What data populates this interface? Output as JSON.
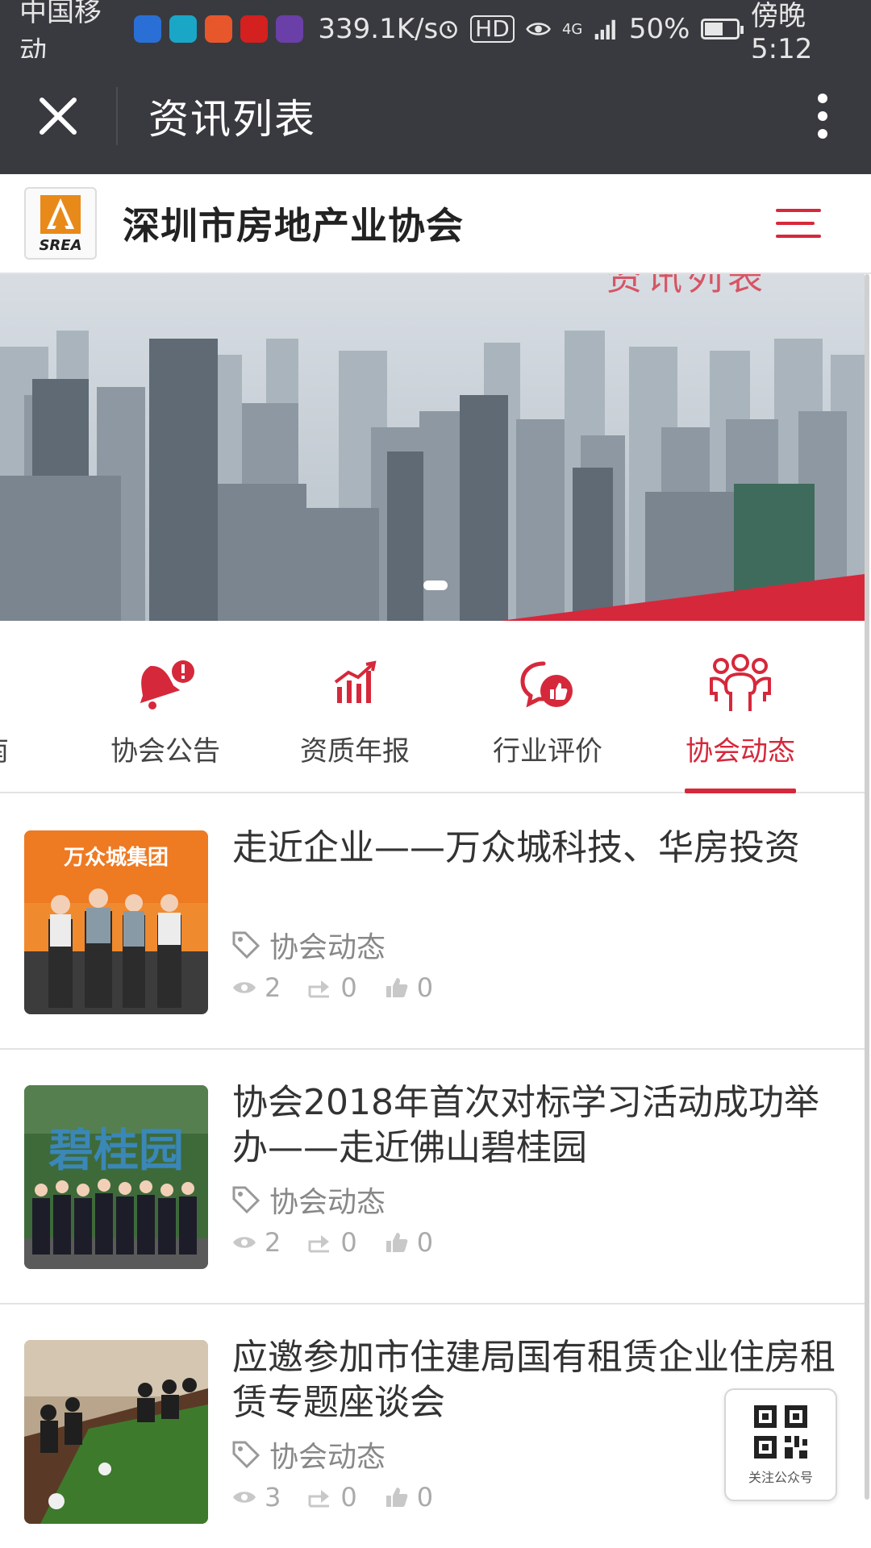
{
  "status_bar": {
    "carrier": "中国移动",
    "speed": "339.1K/s",
    "hd": "HD",
    "network": "4G",
    "battery": "50%",
    "battery_level": 0.5,
    "time": "傍晚5:12"
  },
  "title_bar": {
    "title": "资讯列表"
  },
  "site_header": {
    "logo_text": "SREA",
    "name": "深圳市房地产业协会"
  },
  "banner": {
    "caption": "资讯列表"
  },
  "categories": [
    {
      "label": "南",
      "icon": "compass-icon"
    },
    {
      "label": "协会公告",
      "icon": "bell-alert-icon"
    },
    {
      "label": "资质年报",
      "icon": "bar-chart-icon"
    },
    {
      "label": "行业评价",
      "icon": "chat-thumbs-up-icon"
    },
    {
      "label": "协会动态",
      "icon": "people-group-icon",
      "active": true
    }
  ],
  "news": [
    {
      "title": "走近企业——万众城科技、华房投资",
      "thumb_text": "万众城集团",
      "tag": "协会动态",
      "views": "2",
      "shares": "0",
      "likes": "0"
    },
    {
      "title": "协会2018年首次对标学习活动成功举办——走近佛山碧桂园",
      "thumb_text": "碧桂园",
      "tag": "协会动态",
      "views": "2",
      "shares": "0",
      "likes": "0"
    },
    {
      "title": "应邀参加市住建局国有租赁企业住房租赁专题座谈会",
      "tag": "协会动态",
      "views": "3",
      "shares": "0",
      "likes": "0"
    }
  ],
  "qr_button": {
    "label": "关注公众号"
  },
  "colors": {
    "accent": "#d6283b",
    "titlebar_bg": "#393a3f"
  }
}
